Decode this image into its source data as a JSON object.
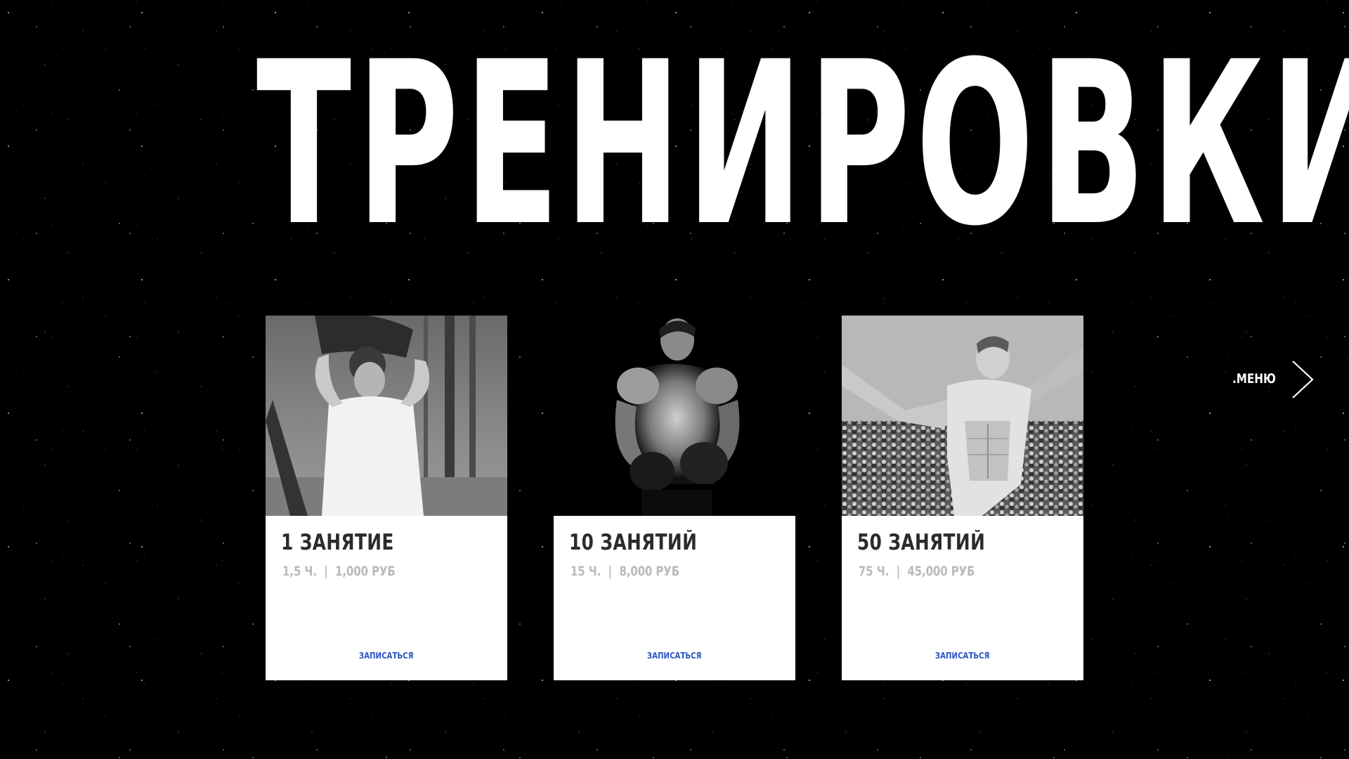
{
  "page": {
    "title": "ТРЕНИРОВКИ"
  },
  "menu": {
    "label": ".МЕНЮ",
    "icon": "chevron-right-icon"
  },
  "colors": {
    "background": "#000000",
    "title": "#ffffff",
    "card_background": "#ffffff",
    "card_title": "#2b2b2b",
    "card_meta": "#b9b9b9",
    "cta": "#2a56c6"
  },
  "plans": [
    {
      "title": "1 ЗАНЯТИЕ",
      "duration": "1,5 Ч.",
      "separator": "|",
      "price": "1,000 РУБ",
      "cta": "ЗАПИСАТЬСЯ",
      "photo": "man-carrying-sandbag-photo"
    },
    {
      "title": "10 ЗАНЯТИЙ",
      "duration": "15 Ч.",
      "separator": "|",
      "price": "8,000 РУБ",
      "cta": "ЗАПИСАТЬСЯ",
      "photo": "boxer-with-gloves-photo"
    },
    {
      "title": "50 ЗАНЯТИЙ",
      "duration": "75 Ч.",
      "separator": "|",
      "price": "45,000 РУБ",
      "cta": "ЗАПИСАТЬСЯ",
      "photo": "bodybuilder-posing-photo"
    }
  ]
}
